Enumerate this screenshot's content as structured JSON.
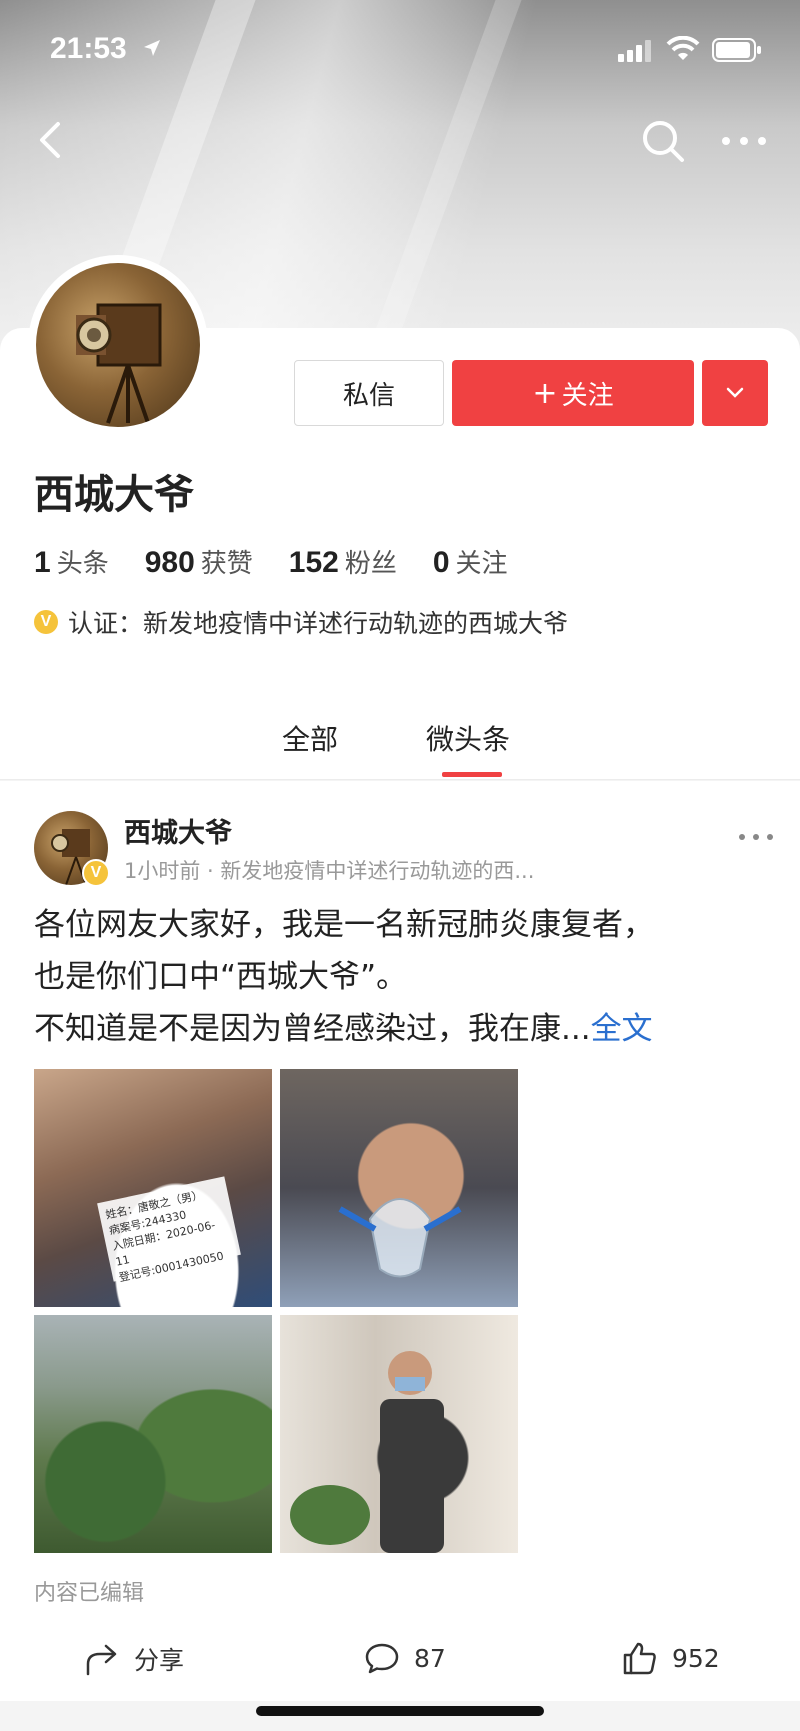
{
  "status_bar": {
    "time": "21:53"
  },
  "profile": {
    "name": "西城大爷",
    "message_button": "私信",
    "follow_button": "关注",
    "stats": [
      {
        "value": "1",
        "label": "头条"
      },
      {
        "value": "980",
        "label": "获赞"
      },
      {
        "value": "152",
        "label": "粉丝"
      },
      {
        "value": "0",
        "label": "关注"
      }
    ],
    "verification": "认证：新发地疫情中详述行动轨迹的西城大爷"
  },
  "tabs": [
    {
      "label": "全部",
      "active": false
    },
    {
      "label": "微头条",
      "active": true
    }
  ],
  "post": {
    "author": "西城大爷",
    "meta": "1小时前 · 新发地疫情中详述行动轨迹的西...",
    "text_lines": [
      "各位网友大家好，我是一名新冠肺炎康复者，",
      "也是你们口中“西城大爷”。",
      "不知道是不是因为曾经感染过，我在康..."
    ],
    "full_text_link": "全文",
    "photo_label_lines": [
      "姓名：唐敬之（男）",
      "病案号:244330",
      "入院日期：2020-06-11",
      "登记号:0001430050"
    ],
    "edited_note": "内容已编辑",
    "share_label": "分享",
    "comment_count": "87",
    "like_count": "952"
  },
  "colors": {
    "accent": "#f04142",
    "link": "#2a6fcf",
    "verify_badge": "#f5c33b"
  }
}
